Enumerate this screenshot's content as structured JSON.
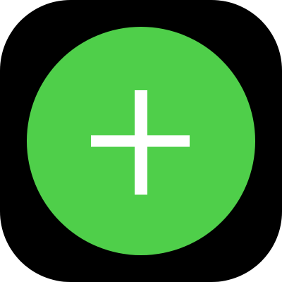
{
  "app_icon": {
    "tile_color": "#000000",
    "button_color": "#4fcf4a",
    "glyph_color": "#ffffff",
    "icon": "plus-icon"
  }
}
